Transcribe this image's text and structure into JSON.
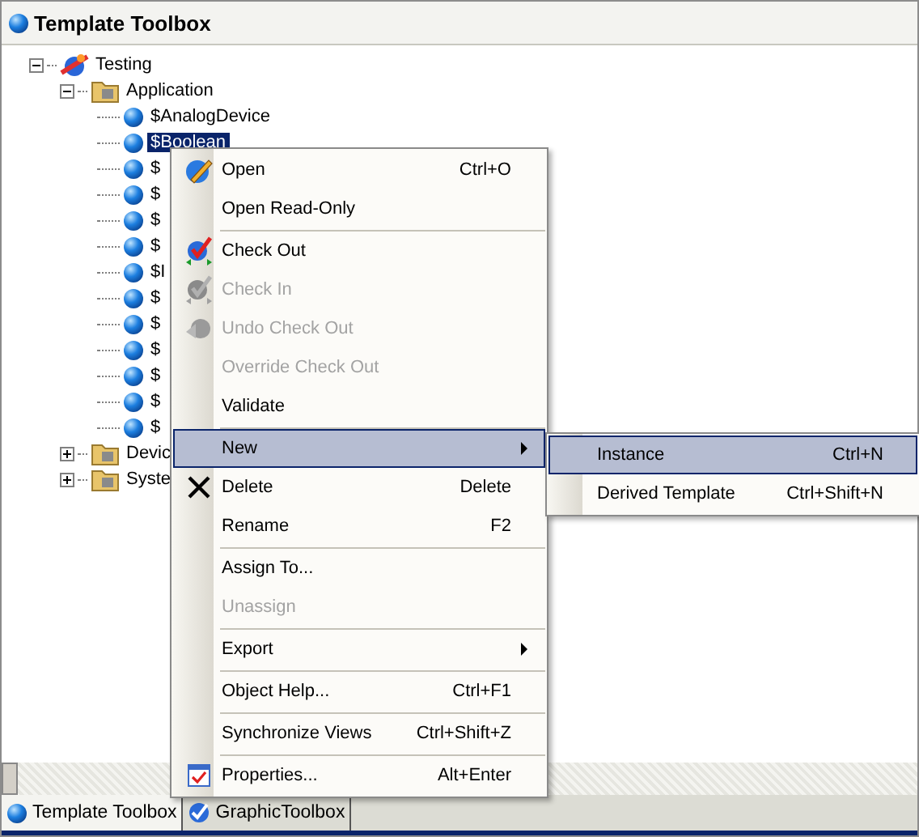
{
  "window": {
    "title": "Template Toolbox"
  },
  "tree": [
    {
      "label": "Testing",
      "kind": "galaxy",
      "expanded": true,
      "selected": false,
      "children": [
        {
          "label": "Application",
          "kind": "folder",
          "expanded": true,
          "selected": false,
          "children": [
            {
              "label": "$AnalogDevice",
              "kind": "template",
              "selected": false
            },
            {
              "label": "$Boolean",
              "kind": "template",
              "selected": true
            },
            {
              "label": "$",
              "kind": "template",
              "selected": false
            },
            {
              "label": "$",
              "kind": "template",
              "selected": false
            },
            {
              "label": "$",
              "kind": "template",
              "selected": false
            },
            {
              "label": "$",
              "kind": "template",
              "selected": false
            },
            {
              "label": "$I",
              "kind": "template",
              "selected": false
            },
            {
              "label": "$",
              "kind": "template",
              "selected": false
            },
            {
              "label": "$",
              "kind": "template",
              "selected": false
            },
            {
              "label": "$",
              "kind": "template",
              "selected": false
            },
            {
              "label": "$",
              "kind": "template",
              "selected": false
            },
            {
              "label": "$",
              "kind": "template",
              "selected": false
            },
            {
              "label": "$",
              "kind": "template",
              "selected": false
            }
          ]
        },
        {
          "label": "Devic",
          "kind": "folder",
          "expanded": false,
          "selected": false
        },
        {
          "label": "Syste",
          "kind": "folder",
          "expanded": false,
          "selected": false
        }
      ]
    }
  ],
  "context_menu": [
    {
      "kind": "item",
      "label": "Open",
      "shortcut": "Ctrl+O",
      "disabled": false,
      "selected": false,
      "submenu": false
    },
    {
      "kind": "item",
      "label": "Open Read-Only",
      "disabled": false,
      "selected": false,
      "submenu": false
    },
    {
      "kind": "separator"
    },
    {
      "kind": "item",
      "label": "Check Out",
      "disabled": false,
      "selected": false,
      "submenu": false
    },
    {
      "kind": "item",
      "label": "Check In",
      "disabled": true,
      "selected": false,
      "submenu": false
    },
    {
      "kind": "item",
      "label": "Undo Check Out",
      "disabled": true,
      "selected": false,
      "submenu": false
    },
    {
      "kind": "item",
      "label": "Override Check Out",
      "disabled": true,
      "selected": false,
      "submenu": false
    },
    {
      "kind": "item",
      "label": "Validate",
      "disabled": false,
      "selected": false,
      "submenu": false
    },
    {
      "kind": "separator"
    },
    {
      "kind": "item",
      "label": "New",
      "disabled": false,
      "selected": true,
      "submenu": true
    },
    {
      "kind": "item",
      "label": "Delete",
      "shortcut": "Delete",
      "disabled": false,
      "selected": false,
      "submenu": false
    },
    {
      "kind": "item",
      "label": "Rename",
      "shortcut": "F2",
      "disabled": false,
      "selected": false,
      "submenu": false
    },
    {
      "kind": "separator"
    },
    {
      "kind": "item",
      "label": "Assign To...",
      "disabled": false,
      "selected": false,
      "submenu": false
    },
    {
      "kind": "item",
      "label": "Unassign",
      "disabled": true,
      "selected": false,
      "submenu": false
    },
    {
      "kind": "separator"
    },
    {
      "kind": "item",
      "label": "Export",
      "disabled": false,
      "selected": false,
      "submenu": true
    },
    {
      "kind": "separator"
    },
    {
      "kind": "item",
      "label": "Object Help...",
      "shortcut": "Ctrl+F1",
      "disabled": false,
      "selected": false,
      "submenu": false
    },
    {
      "kind": "separator"
    },
    {
      "kind": "item",
      "label": "Synchronize Views",
      "shortcut": "Ctrl+Shift+Z",
      "disabled": false,
      "selected": false,
      "submenu": false
    },
    {
      "kind": "separator"
    },
    {
      "kind": "item",
      "label": "Properties...",
      "shortcut": "Alt+Enter",
      "disabled": false,
      "selected": false,
      "submenu": false
    }
  ],
  "submenu": [
    {
      "label": "Instance",
      "shortcut": "Ctrl+N",
      "selected": true
    },
    {
      "label": "Derived Template",
      "shortcut": "Ctrl+Shift+N",
      "selected": false
    }
  ],
  "tabs": [
    {
      "label": "Template Toolbox",
      "selected": true
    },
    {
      "label": "GraphicToolbox",
      "selected": false
    }
  ]
}
